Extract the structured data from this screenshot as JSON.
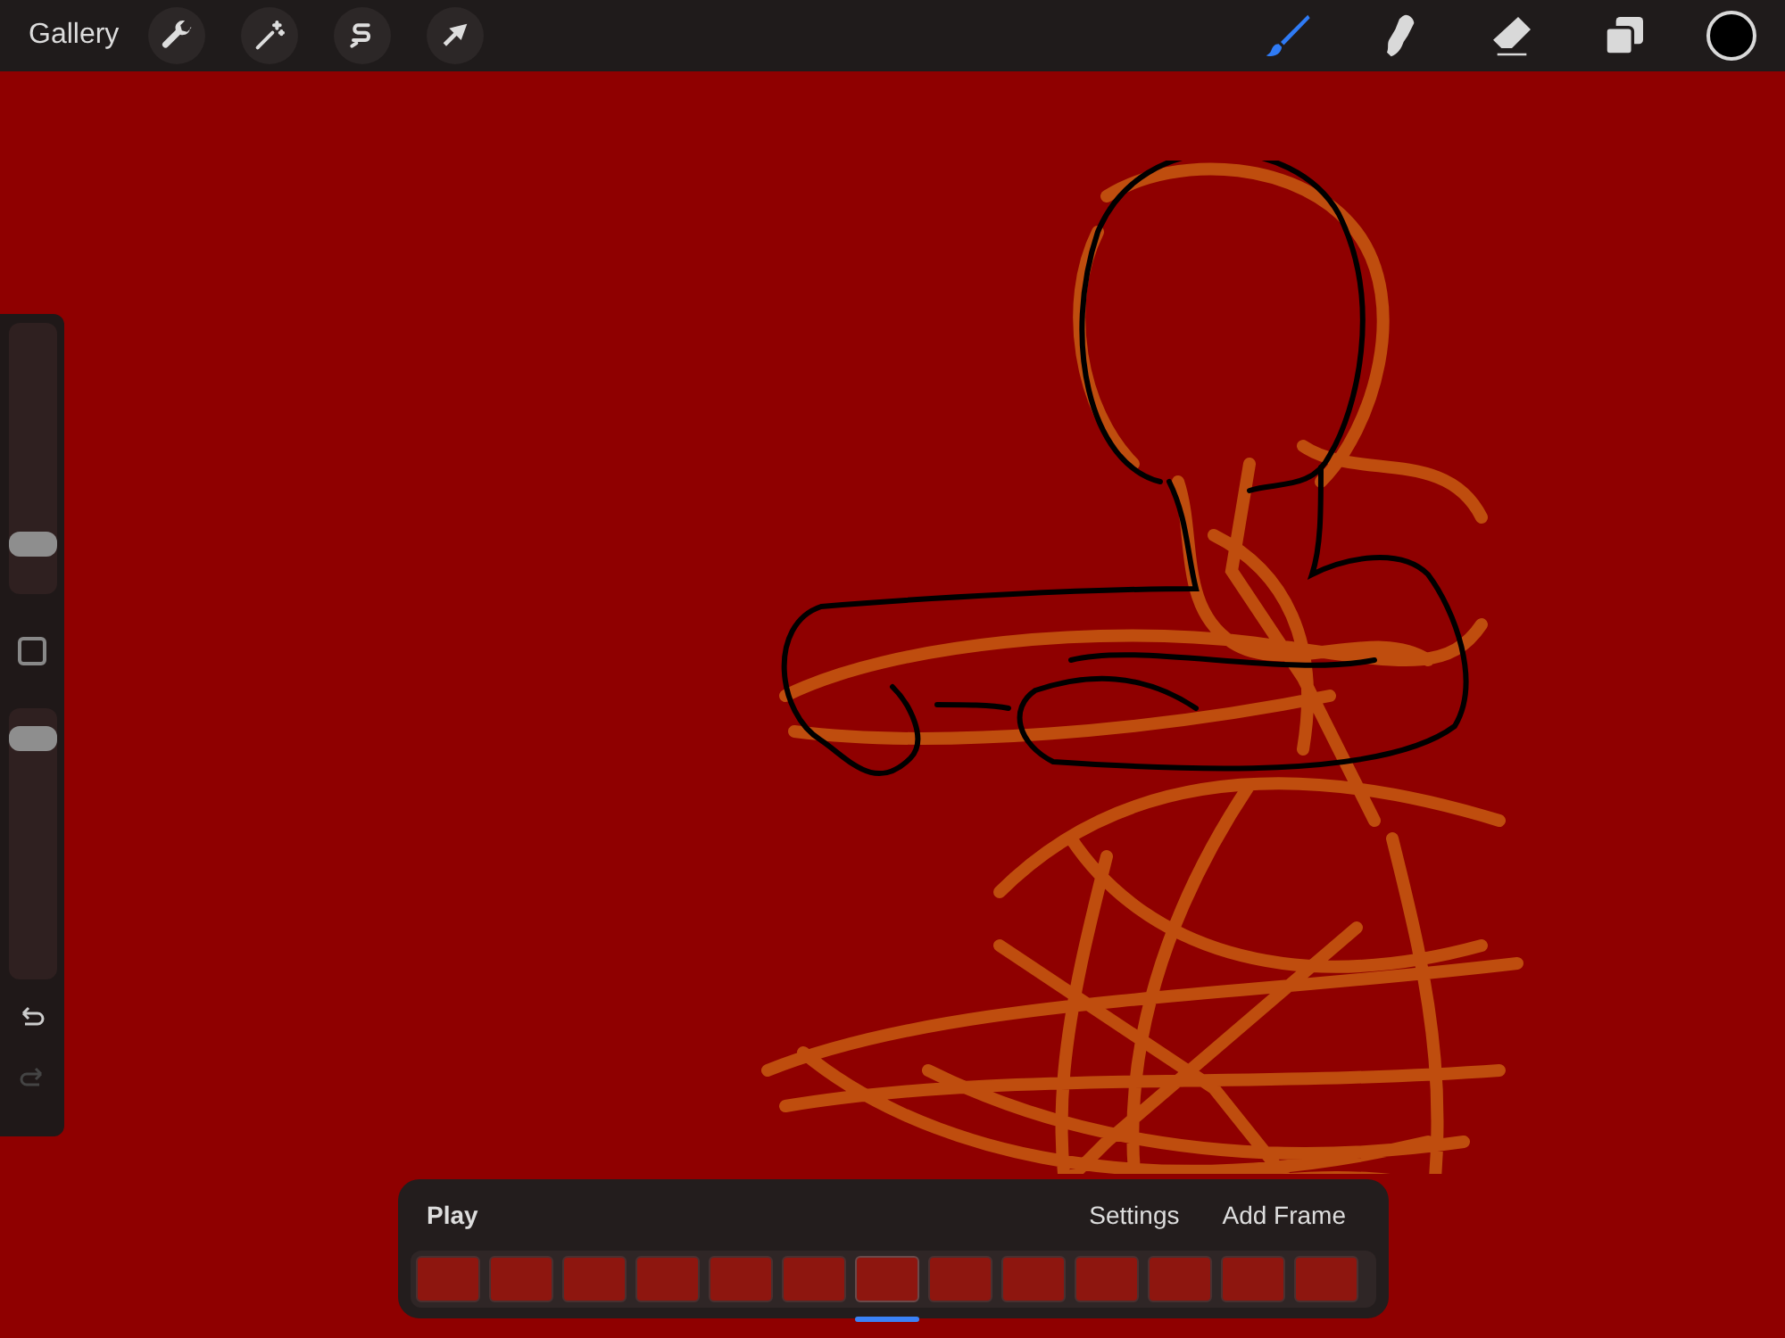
{
  "top_bar": {
    "gallery": "Gallery",
    "actions": [
      {
        "kind": "wrench"
      },
      {
        "kind": "wand"
      },
      {
        "kind": "selection"
      },
      {
        "kind": "move"
      }
    ],
    "tools": [
      {
        "kind": "brush",
        "selected": true
      },
      {
        "kind": "smudge",
        "selected": false
      },
      {
        "kind": "eraser",
        "selected": false
      },
      {
        "kind": "layers",
        "selected": false
      }
    ],
    "color": "#000000"
  },
  "sidebar": {
    "size_slider": {
      "level": 0.15
    },
    "opacity_slider": {
      "level": 0.93
    }
  },
  "timeline": {
    "play": "Play",
    "settings": "Settings",
    "add_frame": "Add Frame",
    "frames": [
      {
        "selected": false
      },
      {
        "selected": false
      },
      {
        "selected": false
      },
      {
        "selected": false
      },
      {
        "selected": false
      },
      {
        "selected": false
      },
      {
        "selected": true
      },
      {
        "selected": false
      },
      {
        "selected": false
      },
      {
        "selected": false
      },
      {
        "selected": false
      },
      {
        "selected": false
      },
      {
        "selected": false
      }
    ]
  }
}
